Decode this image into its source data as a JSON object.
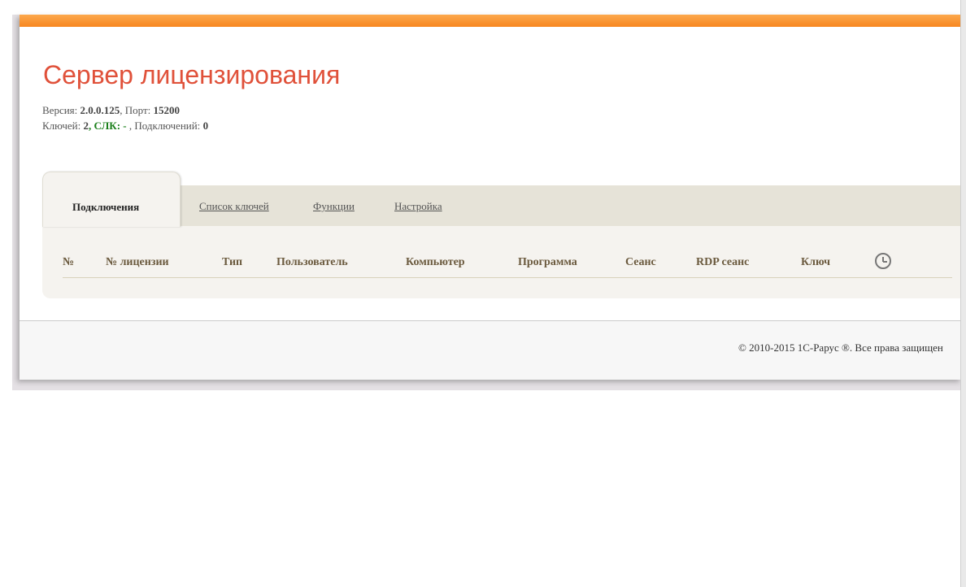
{
  "header": {
    "title": "Сервер лицензирования",
    "version_label": "Версия:",
    "version": "2.0.0.125",
    "port_label": ", Порт:",
    "port": "15200",
    "keys_label": "Ключей:",
    "keys": "2",
    "slk_label": ", СЛК: -",
    "connections_label": " , Подключений:",
    "connections": "0"
  },
  "tabs": [
    {
      "label": "Подключения",
      "active": true
    },
    {
      "label": "Список ключей",
      "active": false
    },
    {
      "label": "Функции",
      "active": false
    },
    {
      "label": "Настройка",
      "active": false
    }
  ],
  "table": {
    "columns": [
      "№",
      "№ лицензии",
      "Тип",
      "Пользователь",
      "Компьютер",
      "Программа",
      "Сеанс",
      "RDP сеанс",
      "Ключ"
    ],
    "last_column_icon": "clock-icon",
    "rows": []
  },
  "footer": {
    "copyright": "© 2010-2015 1С-Рарус ®. Все права защищен"
  },
  "colors": {
    "accent_bar": "#f7861f",
    "title": "#e0513a",
    "slk": "#1a7f1a",
    "column_header": "#6b5a3e"
  }
}
